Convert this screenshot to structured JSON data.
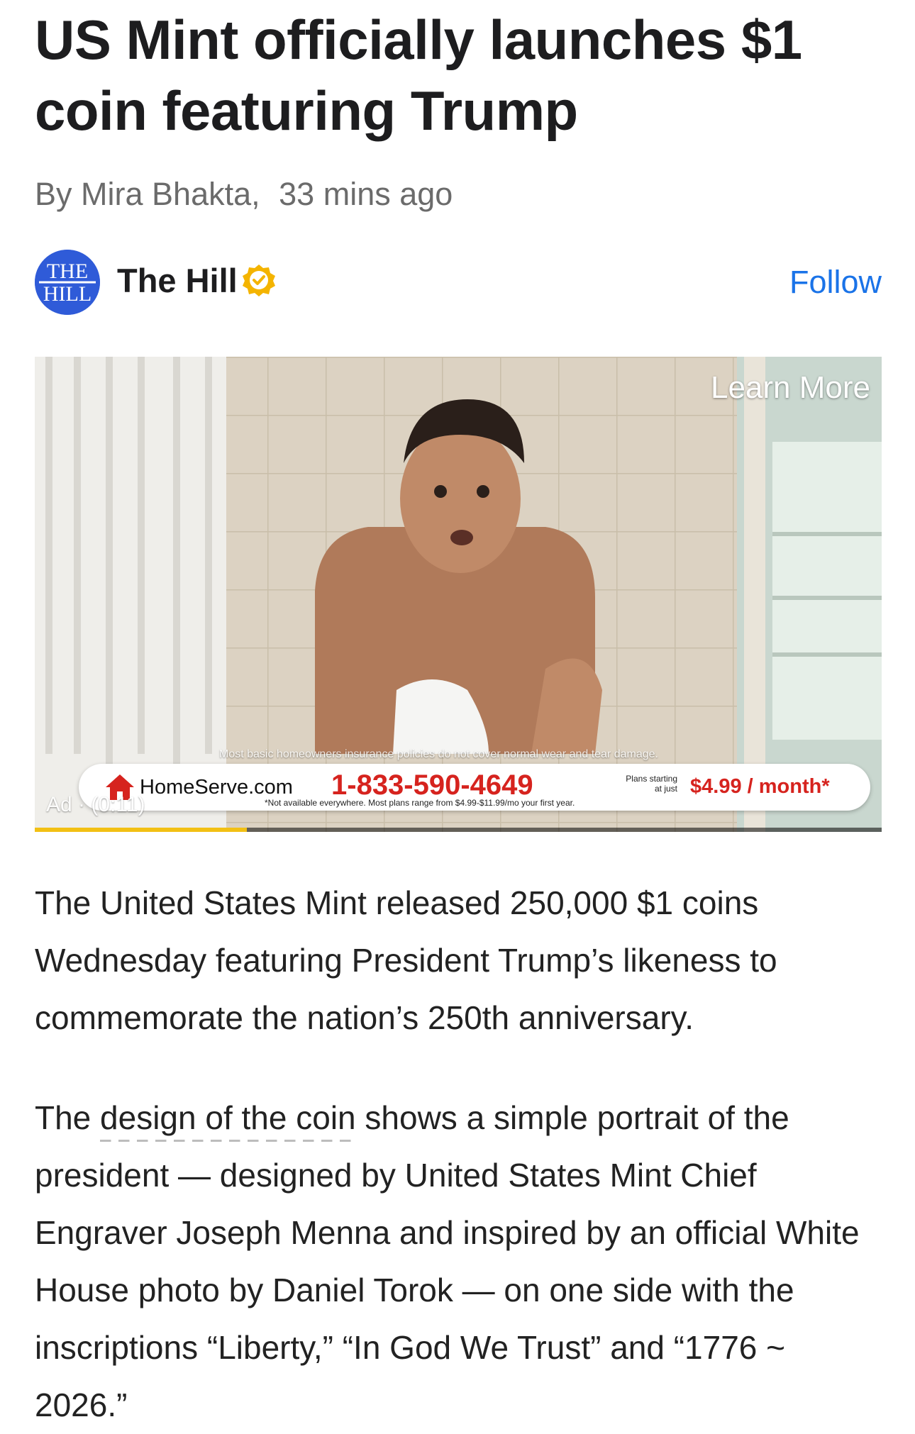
{
  "article": {
    "headline": "US Mint officially launches $1 coin featuring Trump",
    "byline_prefix": "By",
    "author": "Mira Bhakta,",
    "time_ago": "33 mins ago"
  },
  "publisher": {
    "logo_top": "THE",
    "logo_bottom": "HILL",
    "name": "The Hill",
    "verified_icon": "verified-badge-icon",
    "follow_label": "Follow",
    "logo_color": "#2f5bd8",
    "follow_color": "#1a73e8"
  },
  "ad": {
    "learn_more": "Learn More",
    "disclaimer_top": "Most basic homeowners insurance policies do not cover normal wear and tear damage.",
    "brand": "HomeServe.com",
    "phone": "1-833-590-4649",
    "plans_line1": "Plans starting",
    "plans_line2": "at just",
    "price": "$4.99 / month*",
    "fine_print": "*Not available everywhere. Most plans range from $4.99-$11.99/mo your first year.",
    "ad_label": "Ad · (0:11)",
    "progress": 0.25,
    "progress_color": "#f2c014",
    "brand_color": "#d6231e"
  },
  "body": {
    "p1": "The United States Mint released 250,000 $1 coins Wednesday featuring President Trump’s likeness to commemorate the nation’s 250th anniversary.",
    "p2_link": "design of the coin",
    "p2_before": "The ",
    "p2_after": " shows a simple portrait of the president — designed by United States Mint Chief Engraver Joseph Menna and inspired by an official White House photo by Daniel Torok — on one side with the inscriptions “Liberty,” “In God We Trust” and “1776 ~ 2026.”"
  }
}
